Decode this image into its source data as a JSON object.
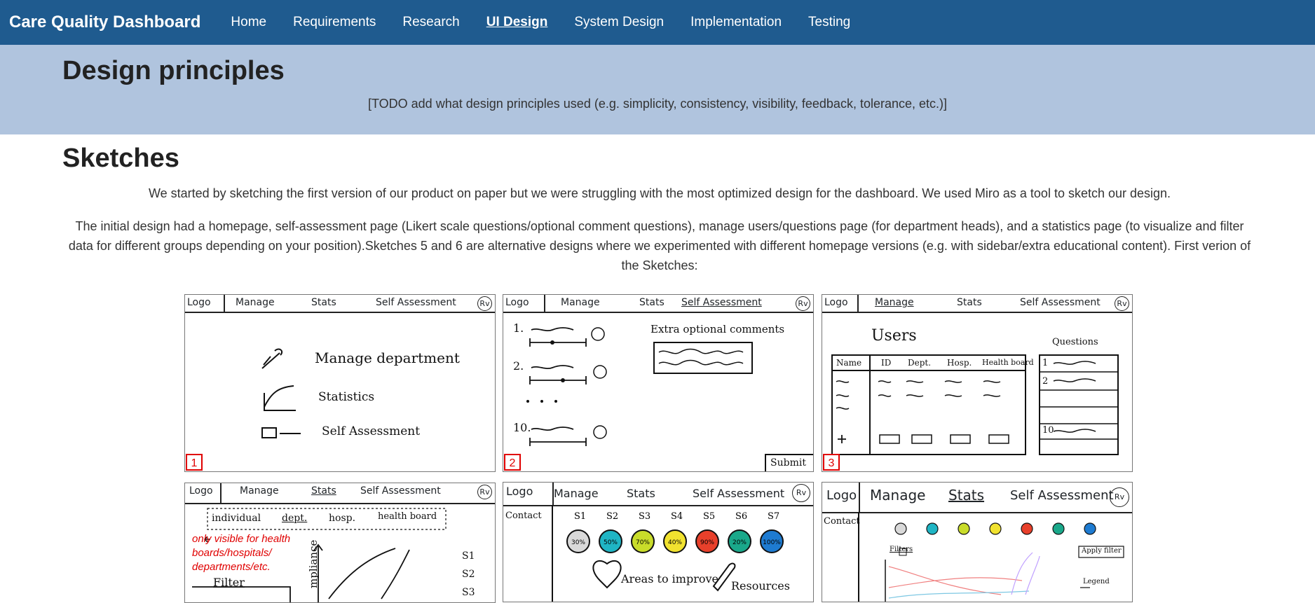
{
  "navbar": {
    "brand": "Care Quality Dashboard",
    "items": [
      "Home",
      "Requirements",
      "Research",
      "UI Design",
      "System Design",
      "Implementation",
      "Testing"
    ],
    "active": "UI Design"
  },
  "banner": {
    "title": "Design principles",
    "text": "[TODO add what design principles used (e.g. simplicity, consistency, visibility, feedback, tolerance, etc.)]"
  },
  "sketches": {
    "title": "Sketches",
    "para1": "We started by sketching the first version of our product on paper but we were struggling with the most optimized design for the dashboard. We used Miro as a tool to sketch our design.",
    "para2": "The initial design had a homepage, self-assessment page (Likert scale questions/optional comment questions), manage users/questions page (for department heads), and a statistics page (to visualize and filter data for different groups depending on your position).Sketches 5 and 6 are alternative designs where we experimented with different homepage versions (e.g. with sidebar/extra educational content). First verion of the Sketches:"
  },
  "sketch_images": {
    "s1": {
      "number": "1",
      "bar": [
        "Logo",
        "Manage",
        "Stats",
        "Self Assessment"
      ],
      "rv": "Rv",
      "items": [
        "Manage department",
        "Statistics",
        "Self Assessment"
      ]
    },
    "s2": {
      "number": "2",
      "bar": [
        "Logo",
        "Manage",
        "Stats",
        "Self Assessment"
      ],
      "rv": "Rv",
      "rows": [
        "1.",
        "2.",
        "10."
      ],
      "comments_label": "Extra optional comments",
      "submit": "Submit"
    },
    "s3": {
      "number": "3",
      "bar": [
        "Logo",
        "Manage",
        "Stats",
        "Self Assessment"
      ],
      "rv": "Rv",
      "users": "Users",
      "cols": [
        "Name",
        "ID",
        "Dept.",
        "Hosp.",
        "Health board"
      ],
      "questions": "Questions",
      "qrows": [
        "1",
        "2",
        "10"
      ]
    },
    "s4": {
      "bar": [
        "Logo",
        "Manage",
        "Stats",
        "Self Assessment"
      ],
      "rv": "Rv",
      "filters": [
        "individual",
        "dept.",
        "hosp.",
        "health board"
      ],
      "note": "only visible for health boards/hospitals/ departments/etc.",
      "filter": "Filter",
      "axis": "mpliance",
      "legend": [
        "S1",
        "S2",
        "S3"
      ]
    },
    "s5": {
      "bar": [
        "Logo",
        "Manage",
        "Stats",
        "Self Assessment"
      ],
      "rv": "Rv",
      "contact": "Contact",
      "circles": [
        "S1",
        "S2",
        "S3",
        "S4",
        "S5",
        "S6",
        "S7"
      ],
      "values": [
        "30%",
        "50%",
        "70%",
        "40%",
        "90%",
        "20%",
        "100%"
      ],
      "areas": "Areas to improve",
      "resources": "Resources"
    },
    "s6": {
      "bar": [
        "Logo",
        "Manage",
        "Stats",
        "Self Assessment"
      ],
      "rv": "Rv",
      "contact": "Contact",
      "filters_label": "Filters",
      "legend": "Legend",
      "apply": "Apply filter"
    }
  }
}
